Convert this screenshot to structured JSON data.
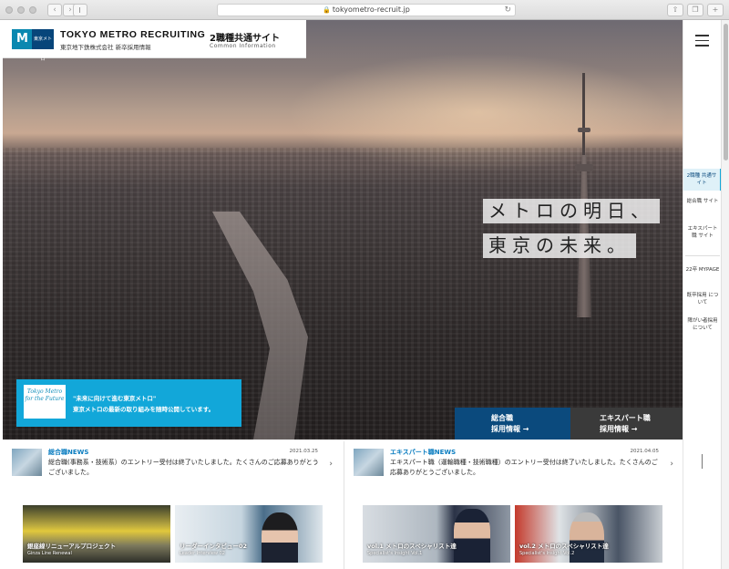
{
  "browser": {
    "url": "tokyometro-recruit.jp",
    "back": "‹",
    "forward": "›"
  },
  "header": {
    "logo_mark_text": "東京メトロ",
    "title": "TOKYO METRO RECRUITING",
    "subtitle": "東京地下鉄株式会社 新卒採用情報",
    "site_name": "2職種共通サイト",
    "site_sub": "Common Information"
  },
  "hero": {
    "catch_line1": "メトロの明日、",
    "catch_line2": "東京の未来。"
  },
  "future_banner": {
    "badge": "Tokyo Metro for the Future",
    "line1": "\"未来に向けて進む東京メトロ\"",
    "line2": "東京メトロの最新の取り組みを随時公開しています。"
  },
  "hero_buttons": {
    "sogo_line1": "総合職",
    "sogo_line2": "採用情報 →",
    "expert_line1": "エキスパート職",
    "expert_line2": "採用情報 →"
  },
  "rail": {
    "items": [
      {
        "label": "2職種 共通サイト",
        "active": true
      },
      {
        "label": "総合職 サイト"
      },
      {
        "label": "エキスパート職 サイト"
      },
      {
        "label": "22卒 MYPAGE"
      },
      {
        "label": "既卒採用 について"
      },
      {
        "label": "障がい者採用 について"
      }
    ]
  },
  "news": {
    "sogo": {
      "category": "総合職NEWS",
      "date": "2021.03.25",
      "text": "総合職(事務系・技術系）のエントリー受付は終了いたしました。たくさんのご応募ありがとうございました。",
      "cards": [
        {
          "title": "銀座線リニューアルプロジェクト",
          "sub": "Ginza Line Renewal"
        },
        {
          "title": "リーダーインタビュー02",
          "sub": "Leader Interview 02"
        }
      ]
    },
    "expert": {
      "category": "エキスパート職NEWS",
      "date": "2021.04.05",
      "text": "エキスパート職（運輸職種・技術職種）のエントリー受付は終了いたしました。たくさんのご応募ありがとうございました。",
      "cards": [
        {
          "title": "vol.1 メトロのスペシャリスト達",
          "sub": "Specialist's Insight Vol.1"
        },
        {
          "title": "vol.2 メトロのスペシャリスト達",
          "sub": "Specialist's Insight Vol.2"
        }
      ]
    }
  },
  "colors": {
    "brand_blue": "#0b4a7d",
    "accent_cyan": "#12a7d9",
    "news_title": "#0b7dc0"
  }
}
